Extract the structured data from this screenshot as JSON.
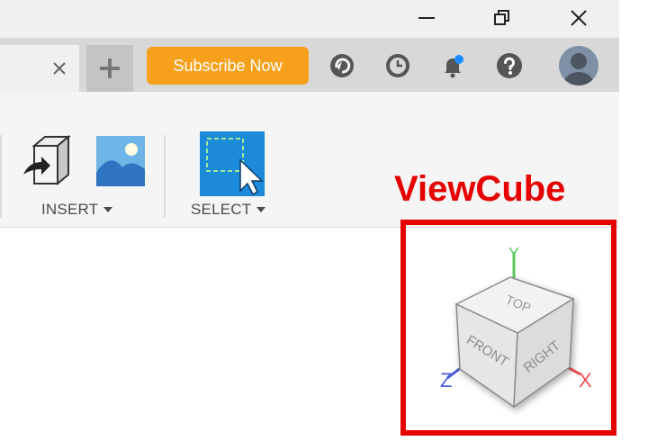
{
  "window": {
    "controls": [
      "minimize",
      "restore",
      "close"
    ]
  },
  "tabs": {
    "close_glyph": "×",
    "new_tab_glyph": "+"
  },
  "header": {
    "subscribe_label": "Subscribe Now",
    "icons": [
      "job-status-icon",
      "history-icon",
      "notifications-icon",
      "help-icon",
      "user-avatar"
    ],
    "colors": {
      "subscribe": "#f7a01c",
      "notification_dot": "#1a8cff"
    }
  },
  "ribbon": {
    "groups": [
      {
        "label": "INSERT",
        "tools": [
          "insert-derive-icon",
          "insert-image-icon"
        ]
      },
      {
        "label": "SELECT",
        "tools": [
          "select-window-icon"
        ]
      }
    ]
  },
  "annotation": {
    "text": "ViewCube",
    "color": "#e60000"
  },
  "viewcube": {
    "faces": {
      "top": "TOP",
      "front": "FRONT",
      "right": "RIGHT"
    },
    "axes": {
      "x": "X",
      "y": "Y",
      "z": "Z"
    },
    "axis_colors": {
      "x": "#f05050",
      "y": "#5cc85c",
      "z": "#4a5fd8"
    }
  }
}
